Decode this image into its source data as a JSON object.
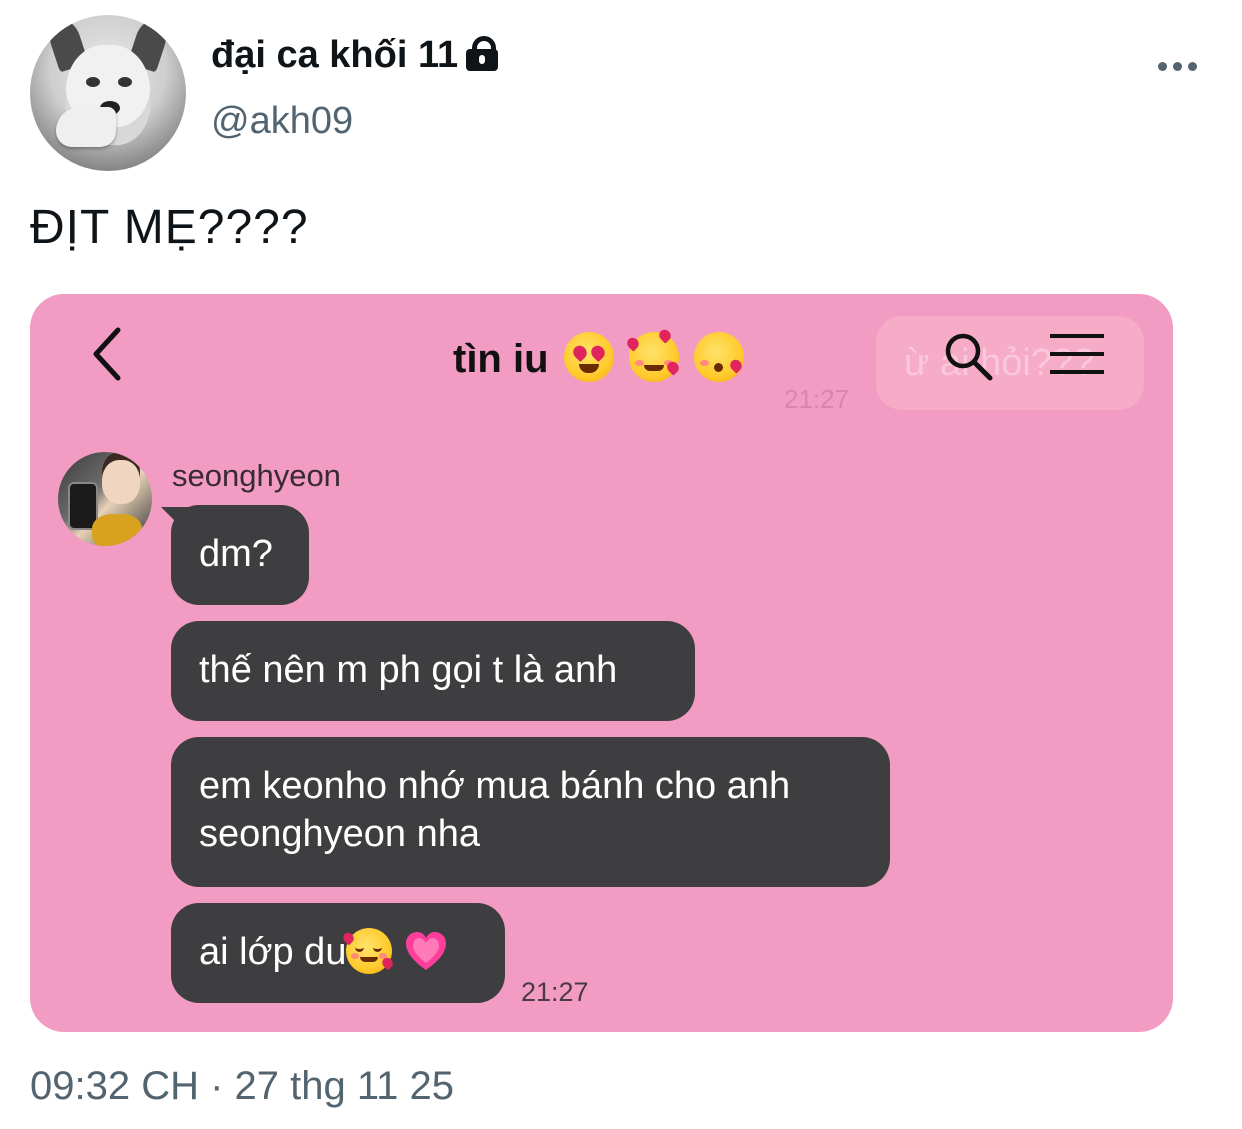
{
  "tweet": {
    "display_name": "đại ca khối 11",
    "handle": "@akh09",
    "text": "ĐỊT MẸ????",
    "timestamp": "09:32 CH · 27 thg 11 25",
    "protected_icon": "lock-icon",
    "more_icon": "more-horizontal-icon"
  },
  "chat": {
    "title": "tìn iu",
    "title_emojis": [
      "heart-eyes-emoji",
      "smiling-face-with-hearts-emoji",
      "face-blowing-kiss-emoji"
    ],
    "ghost_message": "ừ ai hỏi???",
    "ghost_time": "21:27",
    "contact_name": "seonghyeon",
    "messages": [
      {
        "text": "dm?"
      },
      {
        "text": "thế nên m ph gọi t là anh"
      },
      {
        "text": "em keonho nhớ mua bánh cho anh seonghyeon nha"
      },
      {
        "text": "ai lớp du",
        "emojis": [
          "smiling-face-with-hearts-emoji",
          "growing-heart-emoji"
        ]
      }
    ],
    "last_time": "21:27",
    "colors": {
      "background": "#f29cc3",
      "bubble": "#3e3d40"
    }
  }
}
